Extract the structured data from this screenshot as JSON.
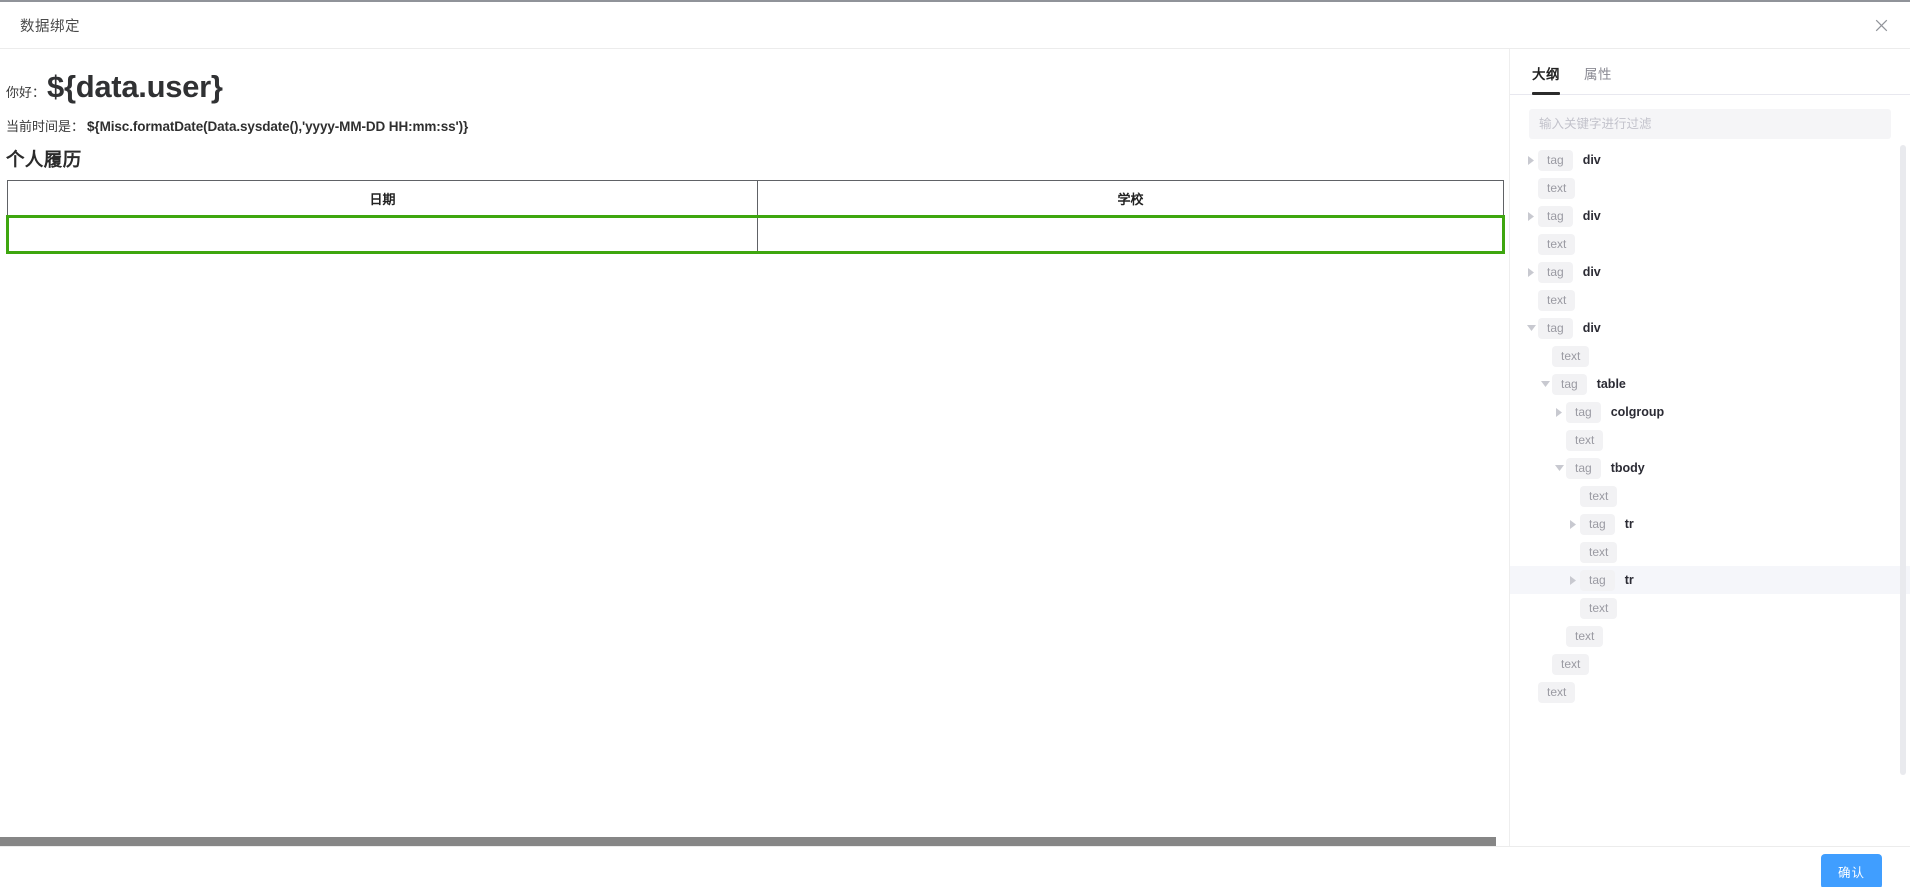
{
  "dialog": {
    "title": "数据绑定",
    "close_icon": "close-icon",
    "confirm_label": "确认"
  },
  "preview": {
    "greeting_label": "你好：",
    "greeting_value": "${data.user}",
    "time_label": "当前时间是：",
    "time_value": "${Misc.formatDate(Data.sysdate(),'yyyy-MM-DD HH:mm:ss')}",
    "section_title": "个人履历",
    "table": {
      "headers": [
        "日期",
        "学校"
      ],
      "rows": [
        {
          "cells": [
            "",
            ""
          ],
          "selected": true
        }
      ],
      "selection_color": "#3ea60f",
      "border_color": "#606266"
    }
  },
  "inspector": {
    "tabs": [
      {
        "label": "大纲",
        "active": true
      },
      {
        "label": "属性",
        "active": false
      }
    ],
    "filter": {
      "value": "",
      "placeholder": "输入关键字进行过滤"
    },
    "tree": [
      {
        "depth": 0,
        "chip": "tag",
        "name": "div",
        "arrow": "right",
        "highlight": false
      },
      {
        "depth": 0,
        "chip": "text",
        "name": "",
        "arrow": "none",
        "highlight": false
      },
      {
        "depth": 0,
        "chip": "tag",
        "name": "div",
        "arrow": "right",
        "highlight": false
      },
      {
        "depth": 0,
        "chip": "text",
        "name": "",
        "arrow": "none",
        "highlight": false
      },
      {
        "depth": 0,
        "chip": "tag",
        "name": "div",
        "arrow": "right",
        "highlight": false
      },
      {
        "depth": 0,
        "chip": "text",
        "name": "",
        "arrow": "none",
        "highlight": false
      },
      {
        "depth": 0,
        "chip": "tag",
        "name": "div",
        "arrow": "down",
        "highlight": false
      },
      {
        "depth": 1,
        "chip": "text",
        "name": "",
        "arrow": "none",
        "highlight": false
      },
      {
        "depth": 1,
        "chip": "tag",
        "name": "table",
        "arrow": "down",
        "highlight": false
      },
      {
        "depth": 2,
        "chip": "tag",
        "name": "colgroup",
        "arrow": "right",
        "highlight": false
      },
      {
        "depth": 2,
        "chip": "text",
        "name": "",
        "arrow": "none",
        "highlight": false
      },
      {
        "depth": 2,
        "chip": "tag",
        "name": "tbody",
        "arrow": "down",
        "highlight": false
      },
      {
        "depth": 3,
        "chip": "text",
        "name": "",
        "arrow": "none",
        "highlight": false
      },
      {
        "depth": 3,
        "chip": "tag",
        "name": "tr",
        "arrow": "right",
        "highlight": false
      },
      {
        "depth": 3,
        "chip": "text",
        "name": "",
        "arrow": "none",
        "highlight": false
      },
      {
        "depth": 3,
        "chip": "tag",
        "name": "tr",
        "arrow": "right",
        "highlight": true
      },
      {
        "depth": 3,
        "chip": "text",
        "name": "",
        "arrow": "none",
        "highlight": false
      },
      {
        "depth": 2,
        "chip": "text",
        "name": "",
        "arrow": "none",
        "highlight": false
      },
      {
        "depth": 1,
        "chip": "text",
        "name": "",
        "arrow": "none",
        "highlight": false
      },
      {
        "depth": 0,
        "chip": "text",
        "name": "",
        "arrow": "none",
        "highlight": false
      }
    ]
  },
  "colors": {
    "accent_blue": "#409eff",
    "selection_green": "#3ea60f",
    "tab_active": "#2b2b2b",
    "chip_bg": "#f2f2f4"
  }
}
